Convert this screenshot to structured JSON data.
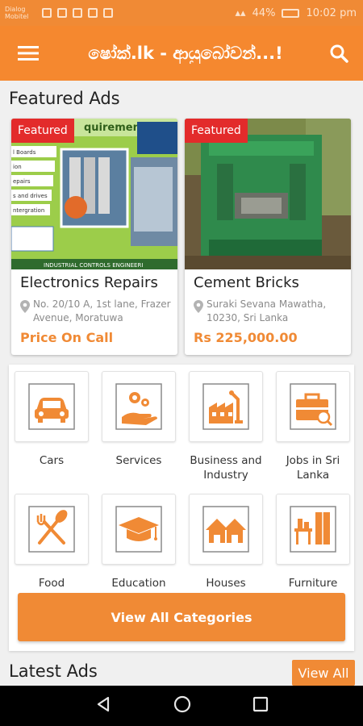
{
  "status": {
    "carrier_line1": "Dialog",
    "carrier_line2": "Mobitel",
    "battery": "44%",
    "time": "10:02 pm"
  },
  "appbar": {
    "title": "ෂෝක්.lk - ආයුබෝවන්...!",
    "menu_icon": "hamburger-menu-icon",
    "search_icon": "search-icon"
  },
  "featured": {
    "title": "Featured Ads",
    "ads": [
      {
        "badge": "Featured",
        "image_banner": "quirements",
        "image_footer": "INDUSTRIAL CONTROLS ENGINEERI",
        "image_lines": [
          "l Boards",
          "ion",
          "epairs",
          "s and drives",
          "ntergration"
        ],
        "title": "Electronics Repairs",
        "location": "No. 20/10 A, 1st lane, Frazer Avenue, Moratuwa",
        "price": "Price On Call"
      },
      {
        "badge": "Featured",
        "title": "Cement Bricks",
        "location": "Suraki Sevana Mawatha, 10230, Sri Lanka",
        "price": "Rs 225,000.00"
      }
    ]
  },
  "categories": {
    "items": [
      {
        "label": "Cars",
        "icon": "car-icon"
      },
      {
        "label": "Services",
        "icon": "services-gear-hand-icon"
      },
      {
        "label": "Business and Industry",
        "icon": "factory-robot-arm-icon"
      },
      {
        "label": "Jobs in Sri Lanka",
        "icon": "briefcase-search-icon"
      },
      {
        "label": "Food",
        "icon": "fork-spoon-icon"
      },
      {
        "label": "Education",
        "icon": "graduation-cap-icon"
      },
      {
        "label": "Houses",
        "icon": "houses-icon"
      },
      {
        "label": "Furniture",
        "icon": "furniture-icon"
      }
    ],
    "view_all_label": "View All Categories"
  },
  "latest": {
    "title": "Latest Ads",
    "view_all_label": "View All"
  },
  "colors": {
    "accent": "#f08a35",
    "badge": "#e32b2b"
  }
}
